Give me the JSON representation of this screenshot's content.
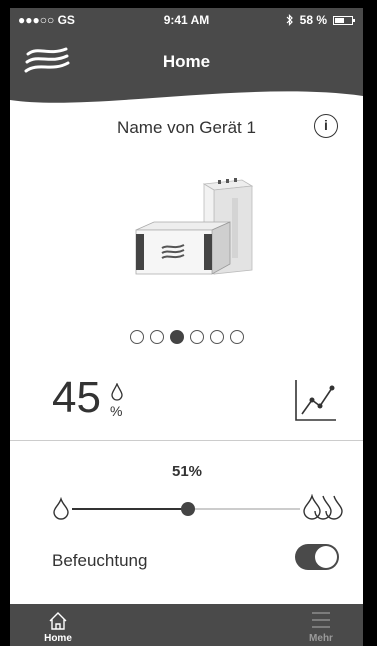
{
  "status_bar": {
    "carrier": "●●●○○ GS",
    "time": "9:41 AM",
    "battery": "58 %",
    "battery_level": 0.58
  },
  "header": {
    "title": "Home",
    "logo_icon": "wave-logo-icon"
  },
  "device": {
    "name": "Name von Gerät 1",
    "info_icon": "info-icon",
    "info_glyph": "i",
    "image": "humidifier-device-image"
  },
  "pagination": {
    "total": 6,
    "active_index": 2
  },
  "humidity": {
    "value": "45",
    "unit": "%",
    "icon": "droplet-icon",
    "trend_icon": "line-chart-icon"
  },
  "target": {
    "label": "51%",
    "value": 51,
    "min_icon": "droplet-small-icon",
    "max_icon": "droplets-large-icon"
  },
  "toggle": {
    "label": "Befeuchtung",
    "on": true
  },
  "tabs": [
    {
      "label": "Home",
      "icon": "home-icon",
      "active": true
    },
    {
      "label": "Mehr",
      "icon": "menu-icon",
      "active": false
    }
  ],
  "colors": {
    "header_bg": "#4a4a4a",
    "text": "#333333",
    "accent": "#444444"
  }
}
